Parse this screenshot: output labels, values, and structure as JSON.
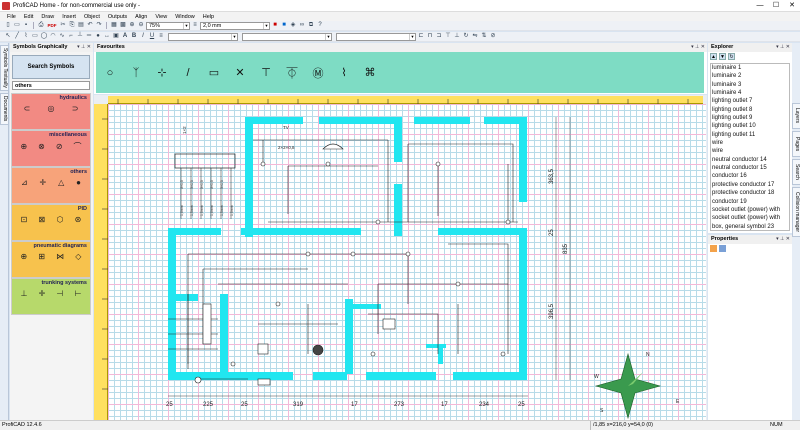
{
  "window": {
    "title": "ProfiCAD Home - for non-commercial use only -",
    "min": "—",
    "max": "☐",
    "close": "✕"
  },
  "menu": [
    "File",
    "Edit",
    "Draw",
    "Insert",
    "Object",
    "Outputs",
    "Align",
    "View",
    "Window",
    "Help"
  ],
  "toolbar": {
    "zoom": "75%",
    "line_width": "2,0 mm",
    "pdf_label": "PDF",
    "bold": "B",
    "italic": "I",
    "underline": "U",
    "text_tool": "A",
    "align_left": "≡"
  },
  "left_tabs": [
    "Symbols Textually",
    "Documents"
  ],
  "symbols": {
    "title": "Symbols Graphically",
    "search_label": "Search Symbols",
    "category_selected": "others",
    "categories": [
      {
        "name": "hydraulics",
        "color": "#f28a83",
        "icons": [
          "⊂",
          "◎",
          "⊃"
        ]
      },
      {
        "name": "miscellaneous",
        "color": "#f28a83",
        "icons": [
          "⊕",
          "⊗",
          "⊘",
          "⌒"
        ]
      },
      {
        "name": "others",
        "color": "#f7a37a",
        "icons": [
          "⊿",
          "✛",
          "△",
          "●"
        ]
      },
      {
        "name": "PID",
        "color": "#f7c24d",
        "icons": [
          "⊡",
          "⊠",
          "⬡",
          "⊛"
        ]
      },
      {
        "name": "pneumatic diagrams",
        "color": "#f7c24d",
        "icons": [
          "⊕",
          "⊞",
          "⋈",
          "◇"
        ]
      },
      {
        "name": "trunking systems",
        "color": "#b7d96b",
        "icons": [
          "⊥",
          "✛",
          "⊣",
          "⊢"
        ]
      }
    ]
  },
  "favourites": {
    "title": "Favourites",
    "icons": [
      "○",
      "ᛉ",
      "⊹",
      "/",
      "▭",
      "✕",
      "⊤",
      "⏁",
      "Ⓜ",
      "⌇",
      "⌘"
    ]
  },
  "drawing": {
    "labels": [
      "TV",
      "2×2×0,8",
      "1×2",
      "3×1,5",
      "3×1,5",
      "3×1,5",
      "3×1,5",
      "3×1,5",
      "1,5mm",
      "1,5mm",
      "1,5mm",
      "1,5mm",
      "1,5mm",
      "1,5mm"
    ],
    "dims_bottom": [
      "25",
      "225",
      "25",
      "319",
      "17",
      "273",
      "17",
      "234",
      "25"
    ],
    "dims_right": [
      "363,5",
      "25",
      "835",
      "396,5"
    ],
    "compass": [
      "N",
      "E",
      "S",
      "W"
    ]
  },
  "explorer": {
    "title": "Explorer",
    "items": [
      "luminaire 1",
      "luminaire 2",
      "luminaire 3",
      "luminaire 4",
      "lighting outlet 7",
      "lighting outlet 8",
      "lighting outlet 9",
      "lighting outlet 10",
      "lighting outlet 11",
      "wire",
      "wire",
      "neutral conductor 14",
      "neutral conductor 15",
      "conductor 16",
      "protective conductor 17",
      "protective conductor 18",
      "conductor 19",
      "socket outlet (power) with",
      "socket outlet (power) with",
      "box, general symbol 23"
    ]
  },
  "properties": {
    "title": "Properties"
  },
  "right_tabs": [
    "Layers",
    "Pages",
    "Search",
    "Collision manager"
  ],
  "status": {
    "version": "ProfiCAD 12.4.6",
    "coords": "/1,85  x=216,0  y=54,0 (0)",
    "num": "NUM"
  },
  "colors": {
    "wall": "#21e6f0",
    "favourites_bg": "#7edcc4",
    "ruler": "#ffe060",
    "grid_minor": "#b7dbe8",
    "grid_major": "#f3b8d8"
  }
}
